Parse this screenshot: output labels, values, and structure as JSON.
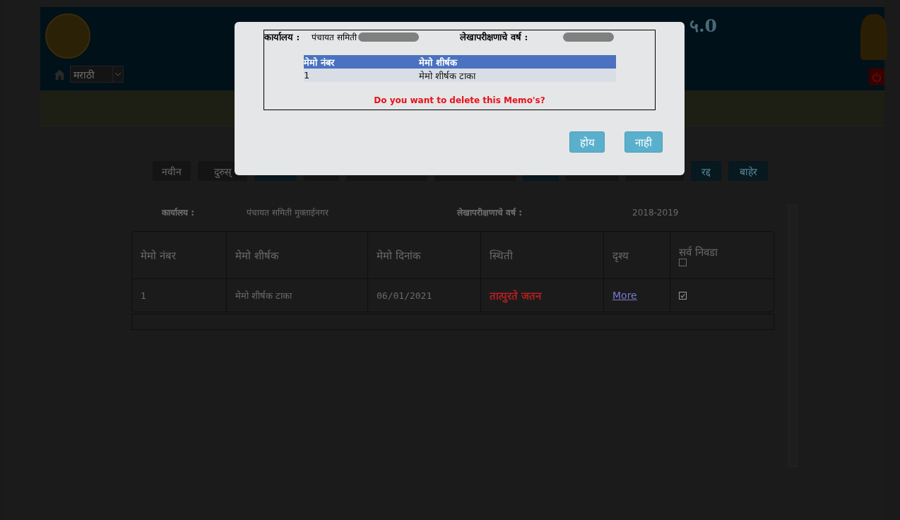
{
  "header": {
    "title_visible": "५.0",
    "language": "मराठी"
  },
  "toolbar": [
    {
      "label": "नवीन",
      "kind": "default"
    },
    {
      "label": "दुरुस्",
      "kind": "default"
    },
    {
      "kind": "primary"
    },
    {
      "kind": "default"
    },
    {
      "kind": "default"
    },
    {
      "kind": "default"
    },
    {
      "kind": "primary"
    },
    {
      "kind": "default"
    },
    {
      "kind": "default"
    },
    {
      "label": "रद्द",
      "kind": "primary"
    },
    {
      "label": "बाहेर",
      "kind": "primary"
    }
  ],
  "info": {
    "office_label": "कार्यालय :",
    "office": "पंचायत समिती मुक्ताईनगर",
    "year_label": "लेखापरीक्षणाचे वर्ष :",
    "year": "2018-2019"
  },
  "table": {
    "columns": [
      "मेमो नंबर",
      "मेमो शीर्षक",
      "मेमो दिनांक",
      "स्थिती",
      "दृश्य",
      "सर्व निवडा"
    ],
    "select_all_checked": false,
    "rows": [
      {
        "memo_no": "1",
        "title": "मेमो शीर्षक टाका",
        "date": "06/01/2021",
        "status": "तात्पुरते जतन",
        "view": "More",
        "checked": true
      }
    ]
  },
  "dialog": {
    "office_label": "कार्यालय :",
    "office": "पंचायत समिती",
    "year_label": "लेखापरीक्षणाचे वर्ष :",
    "columns": [
      "मेमो नंबर",
      "मेमो शीर्षक"
    ],
    "rows": [
      [
        "1",
        "मेमो शीर्षक टाका"
      ]
    ],
    "message": "Do you want to delete this Memo's?",
    "buttons": [
      "होय",
      "नाही"
    ]
  }
}
